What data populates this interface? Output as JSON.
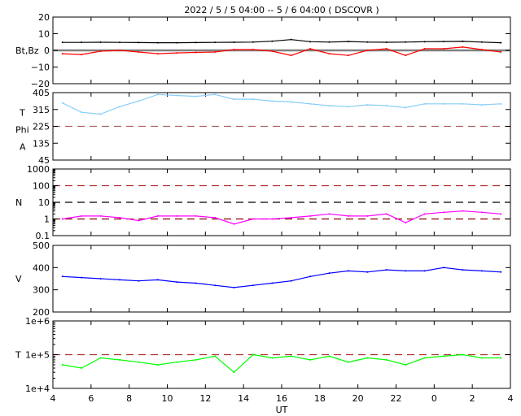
{
  "chart_data": {
    "type": "line",
    "title": "2022  /  5 /  5   04:00  --   5 /  6   04:00 ( DSCOVR )",
    "xlabel": "UT",
    "x_tick_labels": [
      "4",
      "6",
      "8",
      "10",
      "12",
      "14",
      "16",
      "18",
      "20",
      "22",
      "0",
      "2",
      "4"
    ],
    "x_hours_from_start": [
      0,
      1,
      2,
      3,
      4,
      5,
      6,
      7,
      8,
      9,
      10,
      11,
      12,
      13,
      14,
      15,
      16,
      17,
      18,
      19,
      20,
      21,
      22,
      23
    ],
    "panels": [
      {
        "id": "bfield",
        "ylabel": "Bt,Bz",
        "scale": "linear",
        "ylim": [
          -20,
          20
        ],
        "ticks": [
          -20,
          -10,
          0,
          10,
          20
        ],
        "tick_labels": [
          "−20",
          "−10",
          "0",
          "10",
          "20"
        ],
        "refs": [
          {
            "value": 0,
            "color": "#808080",
            "dash": false
          }
        ],
        "series": [
          {
            "name": "Bt",
            "color": "#000000",
            "values": [
              4.8,
              4.8,
              4.9,
              4.8,
              4.7,
              4.6,
              4.6,
              4.7,
              4.8,
              4.9,
              5.0,
              5.5,
              6.5,
              5.2,
              5.0,
              5.3,
              5.0,
              4.9,
              5.0,
              5.2,
              5.3,
              5.4,
              5.0,
              4.6
            ]
          },
          {
            "name": "Bz",
            "color": "#ff0000",
            "values": [
              -2,
              -2.5,
              -0.5,
              0,
              -1,
              -2,
              -1.5,
              -1.2,
              -1,
              0.5,
              0.5,
              -0.5,
              -3,
              1,
              -2,
              -3,
              0,
              1,
              -3,
              1,
              1,
              2,
              0.5,
              -1
            ]
          }
        ]
      },
      {
        "id": "phi",
        "ylabel": [
          "T",
          "Phi",
          "A"
        ],
        "scale": "linear",
        "ylim": [
          45,
          405
        ],
        "ticks": [
          45,
          135,
          225,
          315,
          405
        ],
        "tick_labels": [
          "45",
          "135",
          "225",
          "315",
          "405"
        ],
        "refs": [
          {
            "value": 225,
            "color": "#b06060",
            "dash": true
          }
        ],
        "series": [
          {
            "name": "Phi",
            "color": "#87cefa",
            "values": [
              350,
              300,
              290,
              330,
              360,
              395,
              390,
              385,
              395,
              370,
              370,
              360,
              355,
              345,
              335,
              330,
              340,
              335,
              325,
              345,
              345,
              345,
              340,
              345
            ]
          }
        ]
      },
      {
        "id": "density",
        "ylabel": "N",
        "scale": "log",
        "ylim": [
          0.1,
          1000
        ],
        "ticks": [
          0.1,
          1,
          10,
          100,
          1000
        ],
        "tick_labels": [
          "0.1",
          "1",
          "10",
          "100",
          "1000"
        ],
        "refs": [
          {
            "value": 1,
            "color": "#8b0000",
            "dash": true
          },
          {
            "value": 10,
            "color": "#000000",
            "dash": true
          },
          {
            "value": 100,
            "color": "#b03030",
            "dash": true
          }
        ],
        "series": [
          {
            "name": "N",
            "color": "#ff00ff",
            "values": [
              1,
              1.5,
              1.5,
              1.2,
              0.8,
              1.5,
              1.5,
              1.5,
              1.2,
              0.5,
              1,
              1,
              1.2,
              1.5,
              2,
              1.5,
              1.5,
              2,
              0.6,
              2,
              2.5,
              3,
              2.5,
              2
            ]
          }
        ]
      },
      {
        "id": "velocity",
        "ylabel": "V",
        "scale": "linear",
        "ylim": [
          200,
          500
        ],
        "ticks": [
          200,
          300,
          400,
          500
        ],
        "tick_labels": [
          "200",
          "300",
          "400",
          "500"
        ],
        "refs": [],
        "series": [
          {
            "name": "V",
            "color": "#0000ff",
            "values": [
              360,
              355,
              350,
              345,
              340,
              345,
              335,
              330,
              320,
              310,
              320,
              330,
              340,
              360,
              375,
              385,
              380,
              390,
              385,
              385,
              400,
              390,
              385,
              380
            ]
          }
        ]
      },
      {
        "id": "temperature",
        "ylabel": "T",
        "scale": "log",
        "ylim": [
          10000,
          1000000
        ],
        "ticks": [
          10000,
          100000,
          1000000
        ],
        "tick_labels": [
          "1e+4",
          "1e+5",
          "1e+6"
        ],
        "refs": [
          {
            "value": 100000,
            "color": "#b03030",
            "dash": true
          }
        ],
        "series": [
          {
            "name": "T",
            "color": "#00ff00",
            "values": [
              50000,
              40000,
              80000,
              70000,
              60000,
              50000,
              60000,
              70000,
              90000,
              30000,
              100000,
              80000,
              90000,
              70000,
              90000,
              60000,
              80000,
              70000,
              50000,
              80000,
              90000,
              100000,
              80000,
              80000
            ]
          }
        ]
      }
    ]
  }
}
